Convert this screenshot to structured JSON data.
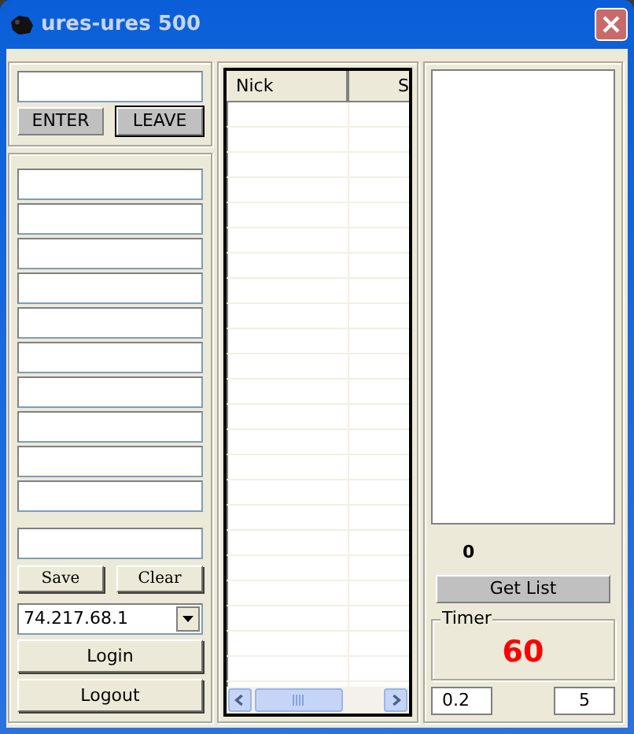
{
  "window": {
    "title": "ures-ures 500"
  },
  "channel_buttons": [
    {
      "label": "ENTER",
      "default": false
    },
    {
      "label": "LEAVE",
      "default": true
    }
  ],
  "preset_buttons": [
    {
      "label": "Save"
    },
    {
      "label": "Clear"
    }
  ],
  "server": {
    "value": "74.217.68.1"
  },
  "login_buttons": [
    {
      "label": "Login"
    },
    {
      "label": "Logout"
    }
  ],
  "table": {
    "columns": [
      "Nick",
      "S"
    ]
  },
  "count": "0",
  "get_list": "Get List",
  "timer": {
    "label": "Timer",
    "value": "60"
  },
  "fields": [
    {
      "value": "0.2"
    },
    {
      "value": "5"
    }
  ]
}
